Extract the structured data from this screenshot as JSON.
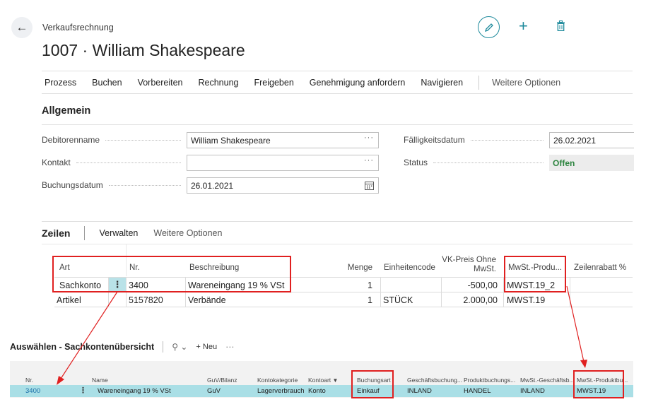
{
  "header": {
    "breadcrumb": "Verkaufsrechnung",
    "title": "1007 · William Shakespeare"
  },
  "actions": [
    "Prozess",
    "Buchen",
    "Vorbereiten",
    "Rechnung",
    "Freigeben",
    "Genehmigung anfordern",
    "Navigieren"
  ],
  "actions_more": "Weitere Optionen",
  "general": {
    "title": "Allgemein",
    "customer_name_label": "Debitorenname",
    "customer_name_value": "William Shakespeare",
    "contact_label": "Kontakt",
    "contact_value": "",
    "posting_date_label": "Buchungsdatum",
    "posting_date_value": "26.01.2021",
    "due_date_label": "Fälligkeitsdatum",
    "due_date_value": "26.02.2021",
    "status_label": "Status",
    "status_value": "Offen",
    "ellipsis": "···"
  },
  "lines": {
    "title": "Zeilen",
    "manage": "Verwalten",
    "more": "Weitere Optionen",
    "columns": {
      "type": "Art",
      "no": "Nr.",
      "description": "Beschreibung",
      "quantity": "Menge",
      "unit": "Einheitencode",
      "price_line1": "VK-Preis Ohne",
      "price_line2": "MwSt.",
      "vat_group": "MwSt.-Produ...",
      "discount": "Zeilenrabatt %"
    },
    "rows": [
      {
        "type": "Sachkonto",
        "no": "3400",
        "description": "Wareneingang 19 % VSt",
        "quantity": "1",
        "unit": "",
        "price": "-500,00",
        "vat_group": "MWST.19_2"
      },
      {
        "type": "Artikel",
        "no": "5157820",
        "description": "Verbände",
        "quantity": "1",
        "unit": "STÜCK",
        "price": "2.000,00",
        "vat_group": "MWST.19"
      }
    ]
  },
  "lookup": {
    "title": "Auswählen - Sachkontenübersicht",
    "search_icon": "search-icon",
    "new_label": "+ Neu",
    "more": "···",
    "columns": {
      "no": "Nr.",
      "name": "Name",
      "income_balance": "GuV/Bilanz",
      "account_category": "Kontokategorie",
      "account_type": "Kontoart",
      "posting_type": "Buchungsart",
      "gen_bus": "Geschäftsbuchung...",
      "gen_prod": "Produktbuchungs...",
      "vat_bus": "MwSt.-Geschäftsb...",
      "vat_prod": "MwSt.-Produktbu..."
    },
    "row": {
      "no": "3400",
      "name": "Wareneingang 19 % VSt",
      "income_balance": "GuV",
      "account_category": "Lagerverbrauch",
      "account_type": "Konto",
      "posting_type": "Einkauf",
      "gen_bus": "INLAND",
      "gen_prod": "HANDEL",
      "vat_bus": "INLAND",
      "vat_prod": "MWST.19"
    }
  },
  "colors": {
    "accent": "#1e8a9c",
    "highlight_red": "#e02020",
    "status_green": "#2e8540",
    "selected_row": "#aadfe6"
  }
}
